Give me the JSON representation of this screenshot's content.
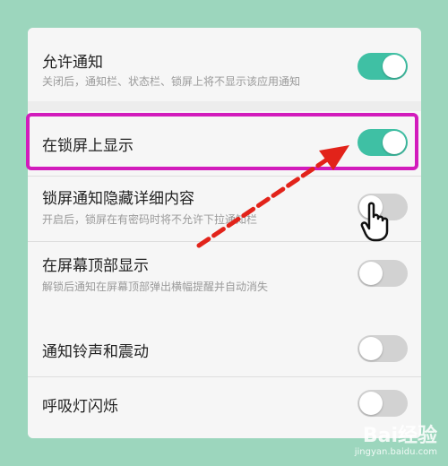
{
  "settings": [
    {
      "title": "允许通知",
      "subtitle": "关闭后，通知栏、状态栏、锁屏上将不显示该应用通知",
      "enabled": true
    },
    {
      "title": "在锁屏上显示",
      "subtitle": "",
      "enabled": true
    },
    {
      "title": "锁屏通知隐藏详细内容",
      "subtitle": "开启后，锁屏在有密码时将不允许下拉通知栏",
      "enabled": false
    },
    {
      "title": "在屏幕顶部显示",
      "subtitle": "解锁后通知在屏幕顶部弹出横幅提醒并自动消失",
      "enabled": false
    },
    {
      "title": "通知铃声和震动",
      "subtitle": "",
      "enabled": false
    },
    {
      "title": "呼吸灯闪烁",
      "subtitle": "",
      "enabled": false
    }
  ],
  "colors": {
    "toggle_on": "#3fc0a4",
    "toggle_off": "#d2d2d2",
    "highlight": "#d21cbc",
    "arrow": "#e2231a",
    "background": "#9cd6bd"
  },
  "watermark": {
    "logo": "Bai经验",
    "url": "jingyan.baidu.com"
  }
}
